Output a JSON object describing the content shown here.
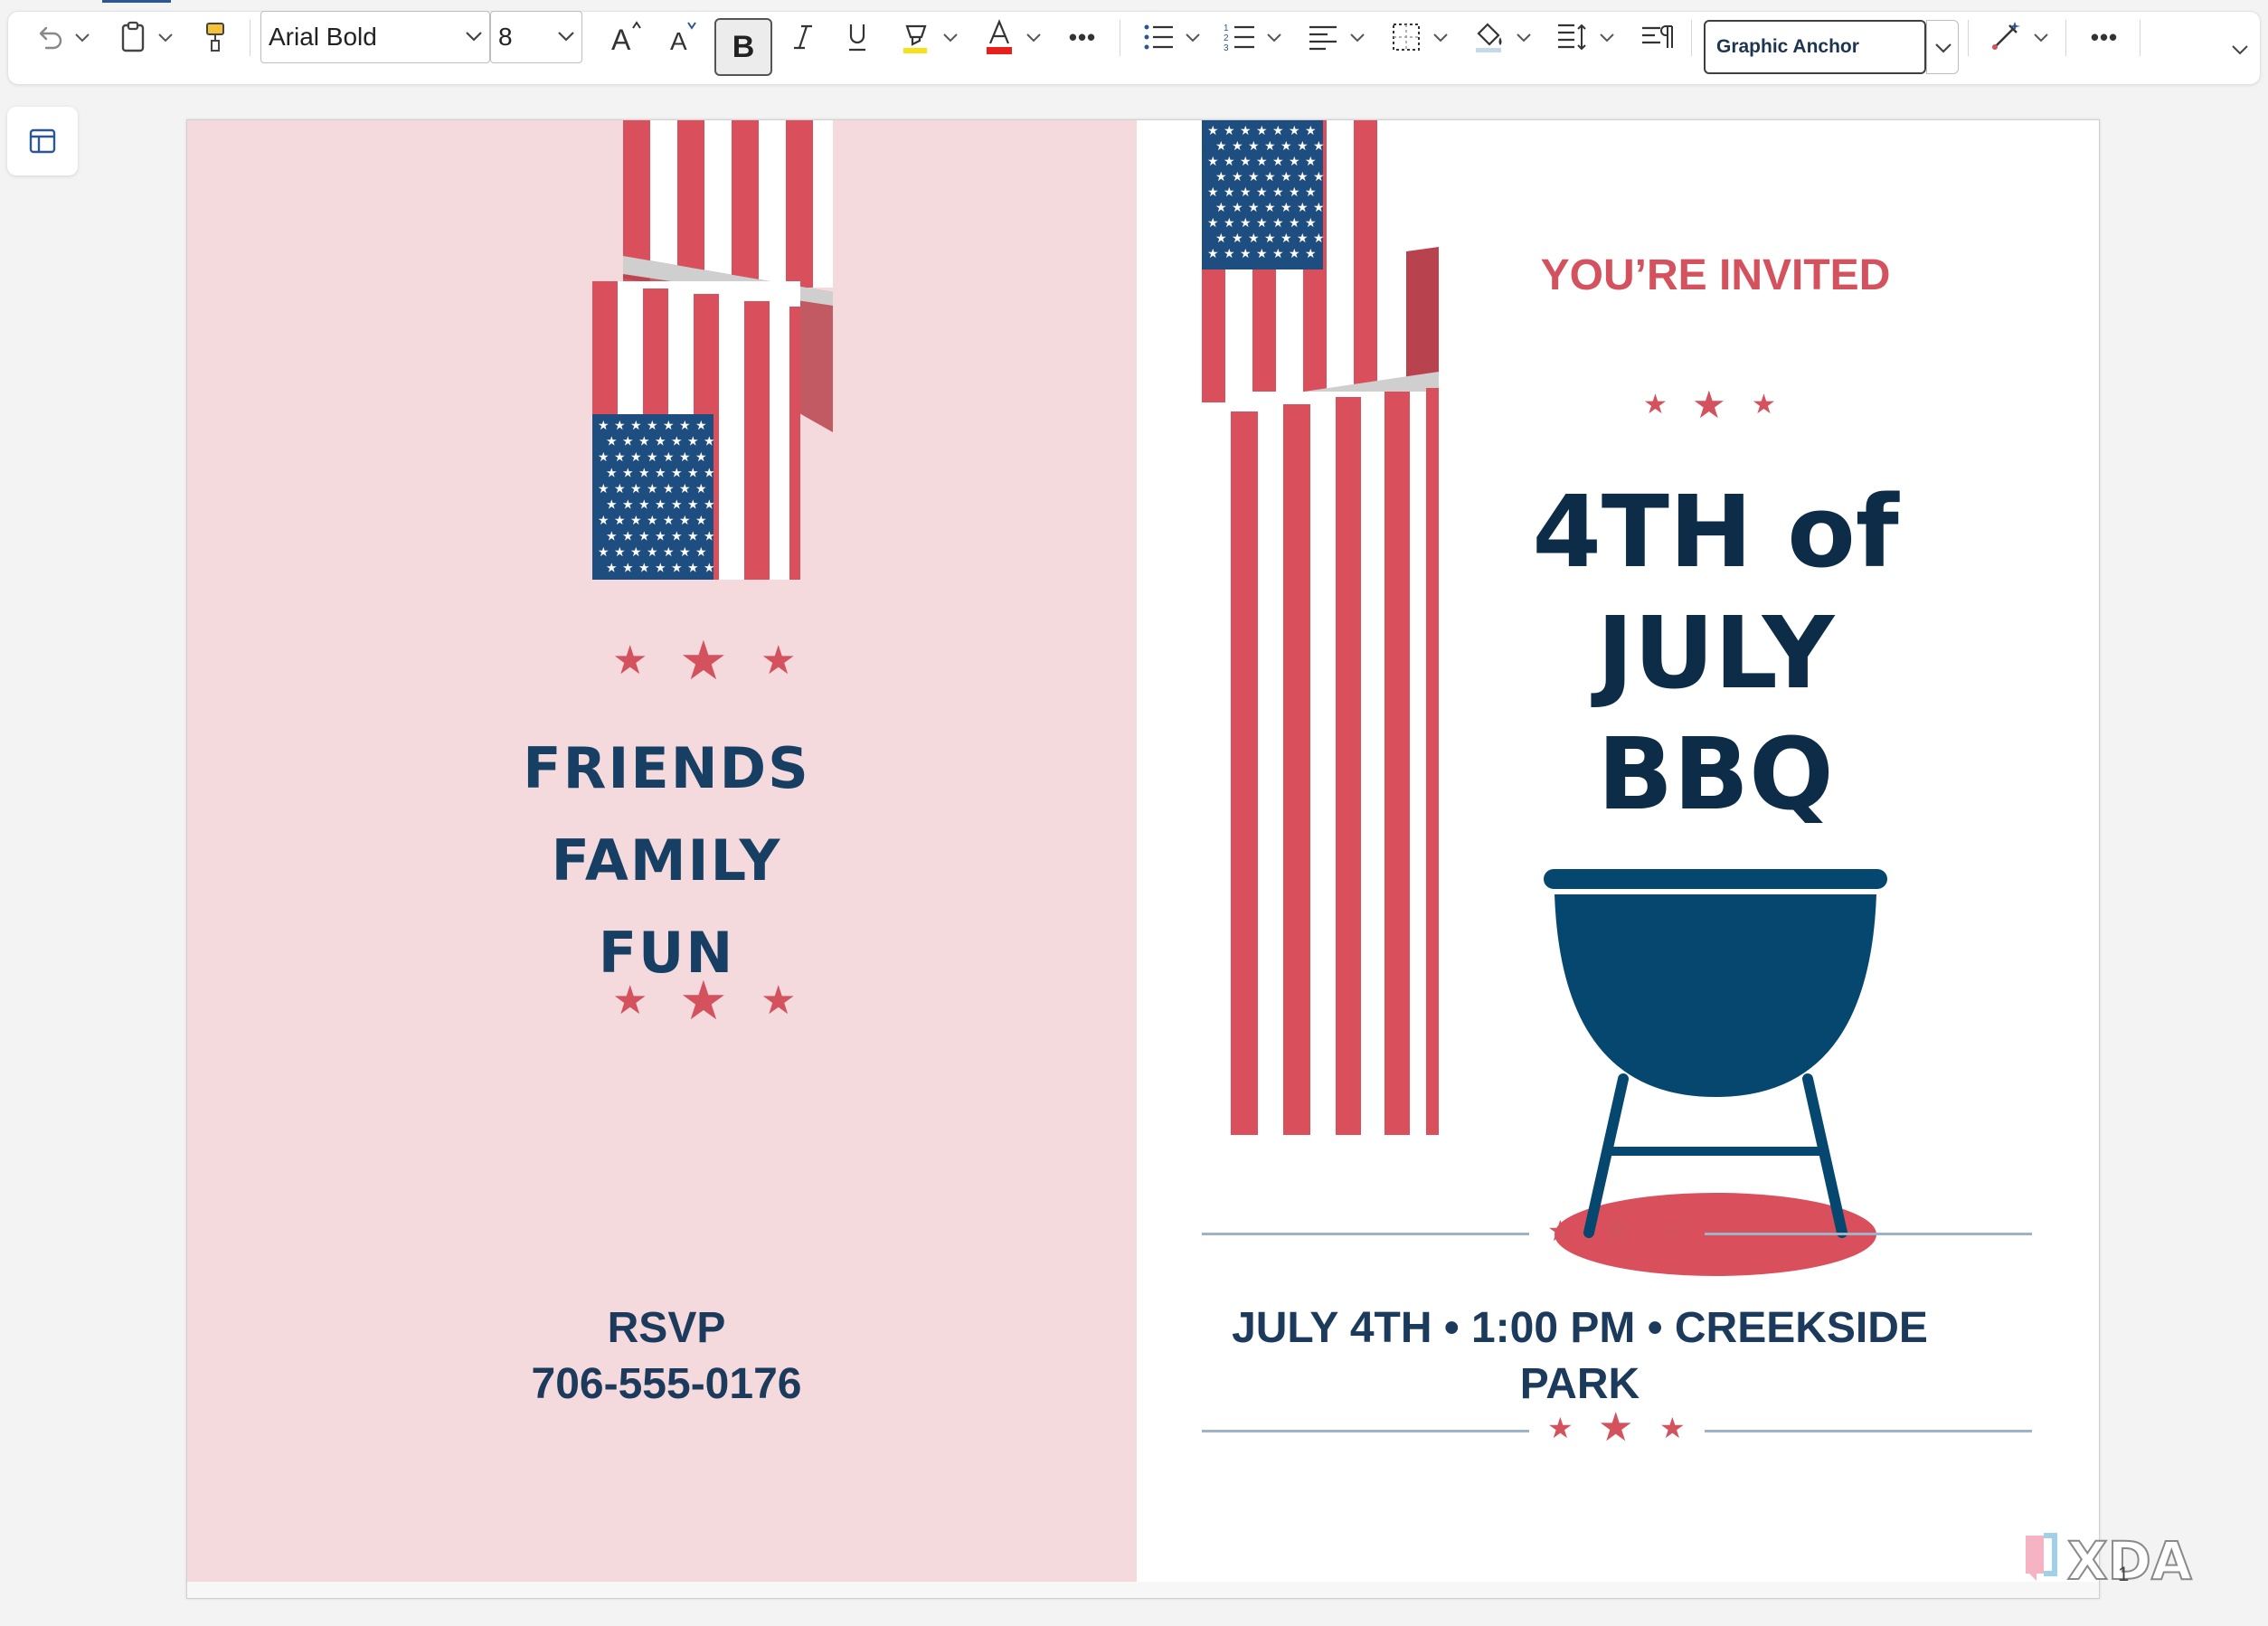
{
  "toolbar": {
    "font_name": "Arial Bold",
    "font_size": "8",
    "bold_label": "B",
    "style_name": "Graphic Anchor",
    "more_label": "•••"
  },
  "colors": {
    "flag_red": "#d94f5c",
    "flag_blue": "#1e4d80",
    "navy_text": "#173f63",
    "accent_red": "#d4515e",
    "left_panel_bg": "#f5dadd",
    "grill_blue": "#06476f",
    "rule_line": "#9fb3c6"
  },
  "left_panel": {
    "friends": "FRIENDS",
    "family": "FAMILY",
    "fun": "FUN",
    "rsvp_label": "RSVP",
    "rsvp_phone": "706-555-0176"
  },
  "right_panel": {
    "invited": "YOU’RE INVITED",
    "title_line1": "4TH of",
    "title_line2": "JULY",
    "title_line3": "BBQ",
    "event_line1": "JULY 4TH • 1:00 PM • CREEKSIDE",
    "event_line2": "PARK"
  },
  "icons": {
    "undo": "undo-icon",
    "clipboard": "clipboard-icon",
    "format_painter": "format-painter-icon",
    "grow_font": "grow-font-icon",
    "shrink_font": "shrink-font-icon",
    "italic": "italic-icon",
    "underline": "underline-icon",
    "highlight": "highlight-icon",
    "font_color": "font-color-icon",
    "bullets": "bullets-icon",
    "numbering": "numbering-icon",
    "align": "align-icon",
    "borders": "borders-icon",
    "shading": "shading-icon",
    "line_spacing": "line-spacing-icon",
    "paragraph": "paragraph-icon",
    "designer": "designer-icon",
    "side_panel": "side-panel-icon"
  },
  "watermark": {
    "text": "XDA",
    "page_number": "1"
  }
}
